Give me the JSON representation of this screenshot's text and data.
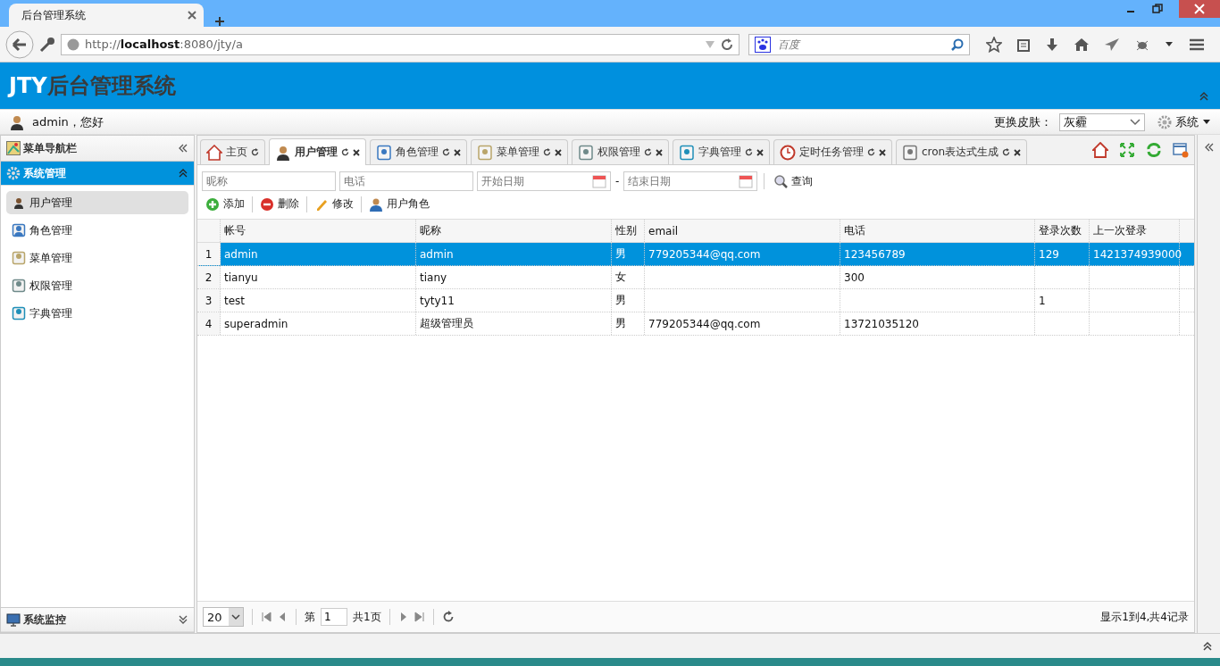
{
  "browser": {
    "tab_title": "后台管理系统",
    "url_scheme": "http://",
    "url_host": "localhost",
    "url_rest": ":8080/jty/a",
    "search_placeholder": "百度"
  },
  "header": {
    "title_prefix": "JTY",
    "title": "后台管理系统"
  },
  "userbar": {
    "greeting": "admin，您好",
    "skin_label": "更换皮肤：",
    "skin_value": "灰霾",
    "system_menu": "系统"
  },
  "sidebar": {
    "title": "菜单导航栏",
    "groups": [
      {
        "label": "系统管理",
        "expanded": true,
        "items": [
          {
            "label": "用户管理",
            "kind": "user",
            "selected": true
          },
          {
            "label": "角色管理",
            "kind": "role",
            "selected": false
          },
          {
            "label": "菜单管理",
            "kind": "menu",
            "selected": false
          },
          {
            "label": "权限管理",
            "kind": "permission",
            "selected": false
          },
          {
            "label": "字典管理",
            "kind": "dict",
            "selected": false
          }
        ]
      },
      {
        "label": "系统监控",
        "expanded": false
      }
    ]
  },
  "tabs": [
    {
      "label": "主页",
      "kind": "home",
      "selected": false,
      "closable": false
    },
    {
      "label": "用户管理",
      "kind": "user",
      "selected": true,
      "closable": true
    },
    {
      "label": "角色管理",
      "kind": "role",
      "selected": false,
      "closable": true
    },
    {
      "label": "菜单管理",
      "kind": "menu",
      "selected": false,
      "closable": true
    },
    {
      "label": "权限管理",
      "kind": "permission",
      "selected": false,
      "closable": true
    },
    {
      "label": "字典管理",
      "kind": "dict",
      "selected": false,
      "closable": true
    },
    {
      "label": "定时任务管理",
      "kind": "clock",
      "selected": false,
      "closable": true
    },
    {
      "label": "cron表达式生成",
      "kind": "cron",
      "selected": false,
      "closable": true
    }
  ],
  "filters": {
    "nickname_placeholder": "昵称",
    "phone_placeholder": "电话",
    "start_placeholder": "开始日期",
    "range_separator": "-",
    "end_placeholder": "结束日期",
    "query_button": "查询"
  },
  "actions": [
    {
      "label": "添加",
      "kind": "add"
    },
    {
      "label": "删除",
      "kind": "delete"
    },
    {
      "label": "修改",
      "kind": "edit"
    },
    {
      "label": "用户角色",
      "kind": "user"
    }
  ],
  "table": {
    "columns": [
      "帐号",
      "昵称",
      "性别",
      "email",
      "电话",
      "登录次数",
      "上一次登录"
    ],
    "rows": [
      {
        "index": "1",
        "selected": true,
        "cells": [
          "admin",
          "admin",
          "男",
          "779205344@qq.com",
          "123456789",
          "129",
          "1421374939000"
        ]
      },
      {
        "index": "2",
        "selected": false,
        "cells": [
          "tianyu",
          "tiany",
          "女",
          "",
          "300",
          "",
          ""
        ]
      },
      {
        "index": "3",
        "selected": false,
        "cells": [
          "test",
          "tyty11",
          "男",
          "",
          "",
          "1",
          ""
        ]
      },
      {
        "index": "4",
        "selected": false,
        "cells": [
          "superadmin",
          "超级管理员",
          "男",
          "779205344@qq.com",
          "13721035120",
          "",
          ""
        ]
      }
    ]
  },
  "pager": {
    "page_size": "20",
    "page_prefix": "第",
    "page": "1",
    "total_pages": "共1页",
    "summary": "显示1到4,共4记录"
  }
}
